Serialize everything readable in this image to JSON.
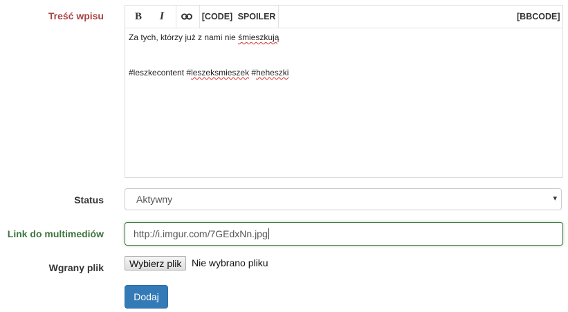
{
  "form": {
    "content_label": "Treść wpisu",
    "status_label": "Status",
    "link_label": "Link do multimediów",
    "file_label": "Wgrany plik",
    "submit_label": "Dodaj"
  },
  "toolbar": {
    "bold_label": "B",
    "italic_label": "I",
    "link_icon": "link-icon",
    "code_label": "[CODE]",
    "spoiler_label": "SPOILER",
    "bbcode_label": "[BBCODE]"
  },
  "editor": {
    "line1_a": "Za tych, którzy już z nami nie ",
    "line1_b": "śmieszkują",
    "line2_a": "#leszkecontent #",
    "line2_b": "leszeksmieszek",
    "line2_c": " #",
    "line2_d": "heheszki"
  },
  "status": {
    "selected": "Aktywny",
    "caret": "▾"
  },
  "link": {
    "value": "http://i.imgur.com/7GEdxNn.jpg"
  },
  "file": {
    "button_label": "Wybierz plik",
    "status_text": "Nie wybrano pliku"
  },
  "colors": {
    "error_label": "#a94442",
    "success_label": "#3c763d",
    "primary_button": "#337ab7"
  }
}
